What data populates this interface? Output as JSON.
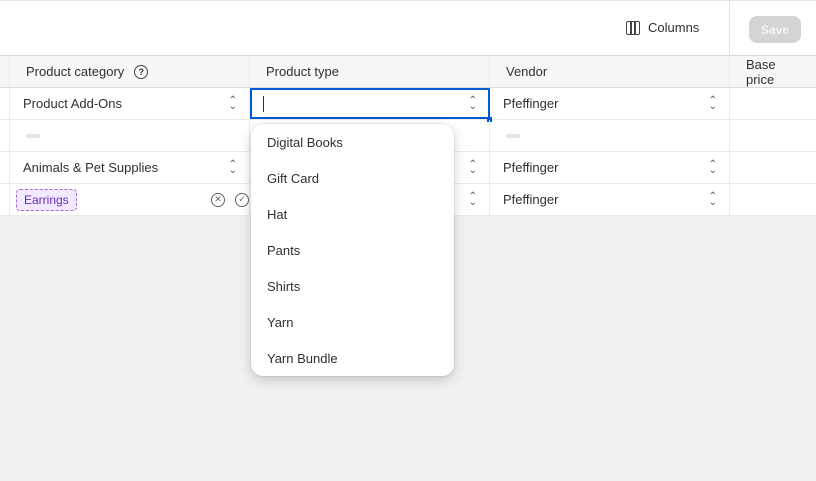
{
  "toolbar": {
    "columns_label": "Columns",
    "save_label": "Save"
  },
  "columns": [
    "Product category",
    "Product type",
    "Vendor",
    "Base price"
  ],
  "rows": [
    {
      "category": "Product Add-Ons",
      "type": "",
      "vendor": "Pfeffinger"
    },
    {
      "category": "",
      "type": "",
      "vendor": ""
    },
    {
      "category": "Animals & Pet Supplies",
      "type": "",
      "vendor": "Pfeffinger"
    },
    {
      "category_tag": "Earrings",
      "type": "",
      "vendor": "Pfeffinger"
    }
  ],
  "dropdown": {
    "options": [
      "Digital Books",
      "Gift Card",
      "Hat",
      "Pants",
      "Shirts",
      "Yarn",
      "Yarn Bundle"
    ]
  }
}
